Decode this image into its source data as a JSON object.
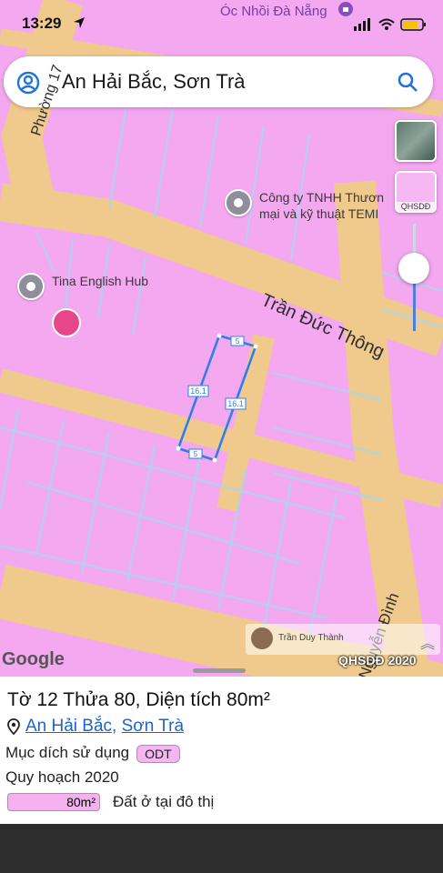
{
  "status_bar": {
    "time": "13:29",
    "poi_name": "Óc Nhồi Đà Nẵng"
  },
  "search": {
    "query": "An Hải Bắc, Sơn Trà"
  },
  "layers": {
    "overlay_label": "QHSDĐ"
  },
  "map": {
    "pois": [
      {
        "name": "Công ty TNHH Thươn\nmại và kỹ thuật TEMI"
      },
      {
        "name": "Tina English Hub"
      }
    ],
    "roads": [
      "Phường 17",
      "Trần Đức Thông",
      "Nguyễn Đình"
    ],
    "parcel_edges": [
      "5",
      "16.1",
      "16.1",
      "5"
    ],
    "google_logo": "Google",
    "overlay_source": "QHSDĐ 2020",
    "attribution_user": "Trần Duy Thành"
  },
  "parcel_info": {
    "title": "Tờ 12 Thửa 80, Diện tích 80m²",
    "ward": "An Hải Bắc",
    "separator": ",",
    "district": "Sơn Trà",
    "land_use_label": "Mục dích sử dụng",
    "land_use_code": "ODT",
    "plan_label": "Quy hoạch 2020",
    "plan_area": "80m²",
    "plan_description": "Đất ở tại đô thị"
  },
  "colors": {
    "residential_zone": "#f3a8f0",
    "road": "#f2c98a",
    "parcel_outline": "#2f7fe8",
    "link": "#1e64c8"
  }
}
